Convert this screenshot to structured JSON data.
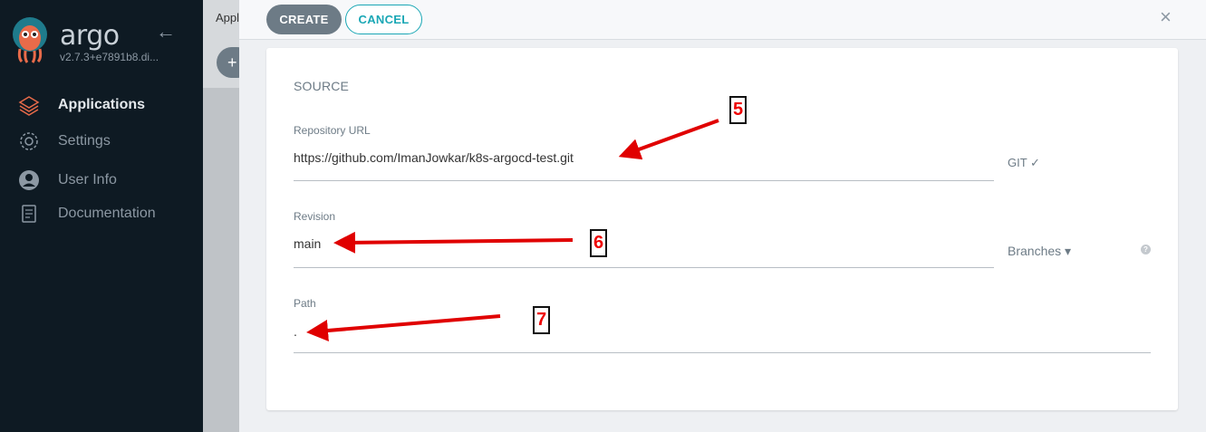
{
  "sidebar": {
    "brand": "argo",
    "version": "v2.7.3+e7891b8.di...",
    "items": [
      {
        "label": "Applications",
        "icon": "layers-icon"
      },
      {
        "label": "Settings",
        "icon": "gear-icon"
      },
      {
        "label": "User Info",
        "icon": "user-icon"
      },
      {
        "label": "Documentation",
        "icon": "book-icon"
      }
    ]
  },
  "background": {
    "title": "Appl",
    "add": "+"
  },
  "panel": {
    "create_label": "CREATE",
    "cancel_label": "CANCEL",
    "close": "×"
  },
  "source": {
    "section_title": "SOURCE",
    "repo_url_label": "Repository URL",
    "repo_url_value": "https://github.com/ImanJowkar/k8s-argocd-test.git",
    "repo_type": "GIT ✓",
    "revision_label": "Revision",
    "revision_value": "main",
    "revision_selector": "Branches ▾",
    "help": "?",
    "path_label": "Path",
    "path_value": "."
  },
  "annotations": {
    "n5": "5",
    "n6": "6",
    "n7": "7"
  },
  "colors": {
    "sidebar_bg": "#0e1a23",
    "accent": "#1aa7b5",
    "button_gray": "#6d7b86",
    "annotation_red": "#e00000"
  }
}
